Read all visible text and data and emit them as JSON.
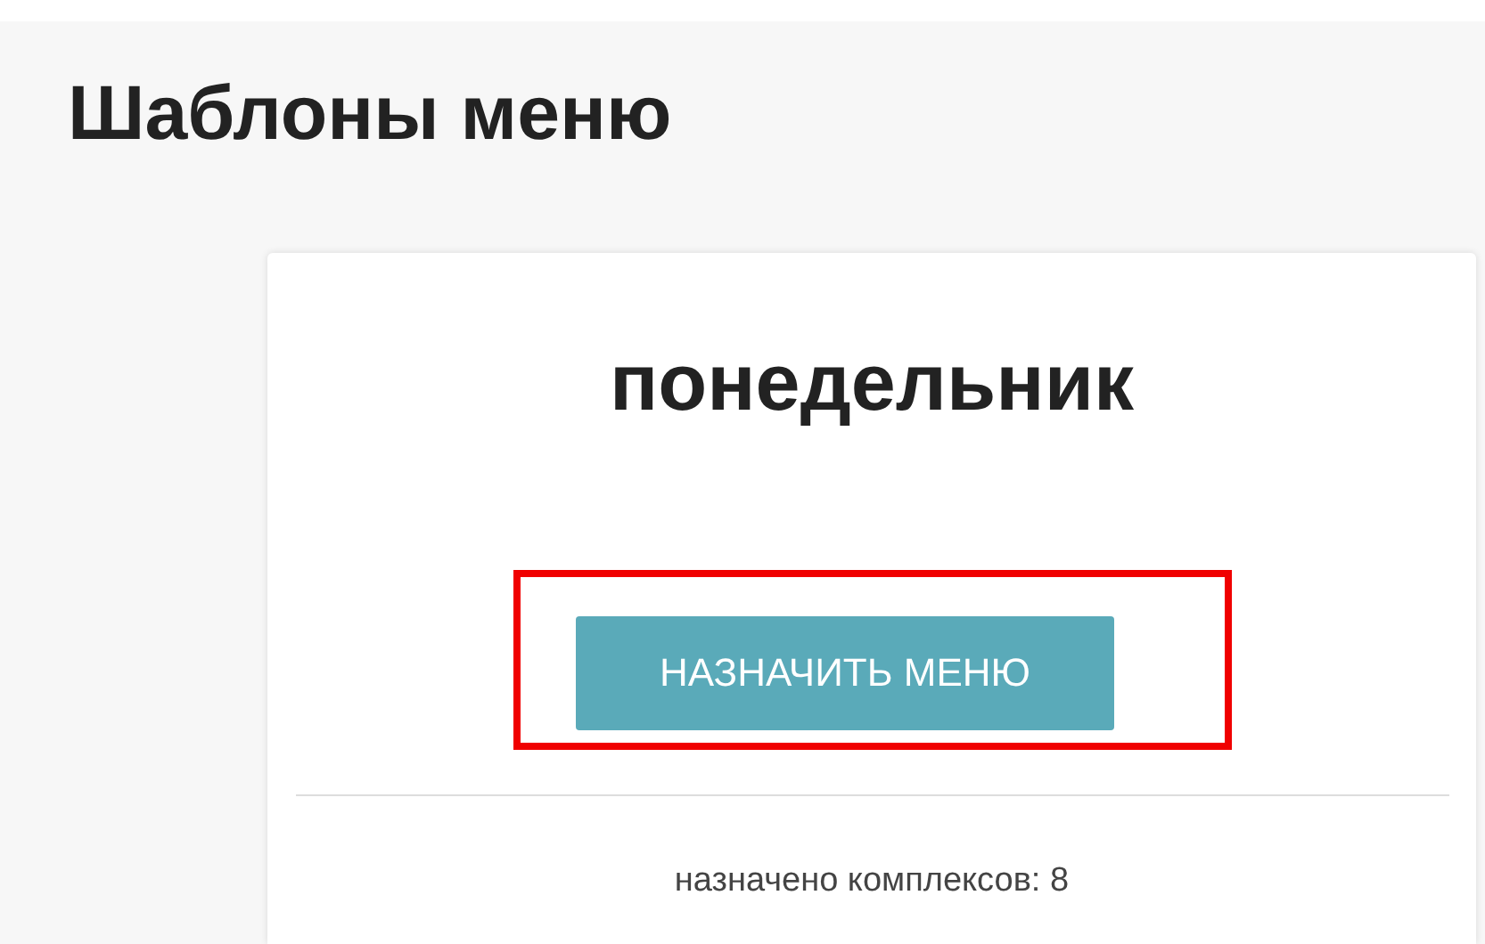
{
  "page_title": "Шаблоны меню",
  "card": {
    "title": "понедельник",
    "button": {
      "label": "НАЗНАЧИТЬ МЕНЮ",
      "highlighted": true
    },
    "footer": "назначено комплексов: 8"
  }
}
